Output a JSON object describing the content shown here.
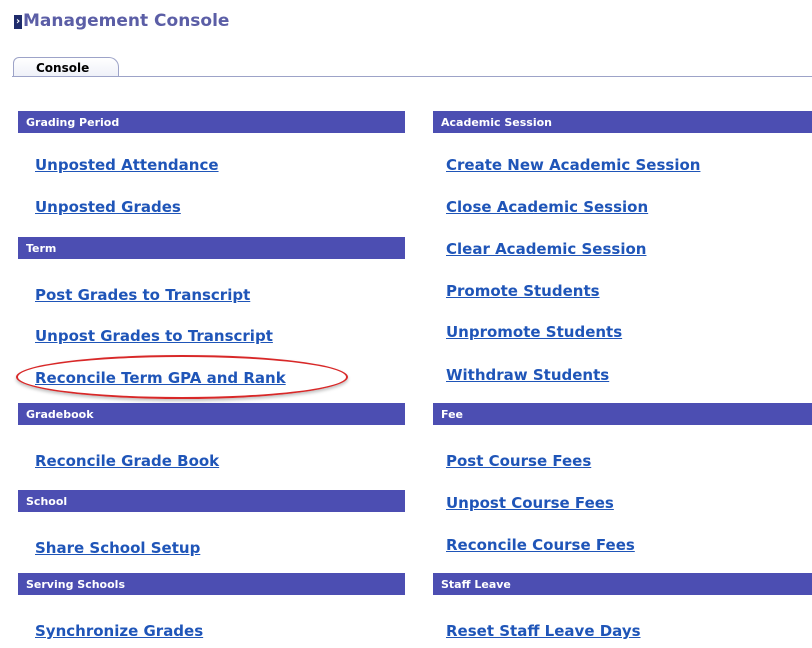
{
  "header": {
    "title": "Management Console",
    "icon": "chevron-right-icon"
  },
  "tabs": [
    {
      "label": "Console"
    }
  ],
  "left": {
    "grading_period": {
      "label": "Grading Period",
      "links": [
        "Unposted Attendance",
        "Unposted Grades"
      ]
    },
    "term": {
      "label": "Term",
      "links": [
        "Post Grades to Transcript",
        "Unpost Grades to Transcript",
        "Reconcile Term GPA and Rank"
      ]
    },
    "gradebook": {
      "label": "Gradebook",
      "links": [
        "Reconcile Grade Book"
      ]
    },
    "school": {
      "label": "School",
      "links": [
        "Share School Setup"
      ]
    },
    "serving_schools": {
      "label": "Serving Schools",
      "links": [
        "Synchronize Grades"
      ]
    }
  },
  "right": {
    "academic_session": {
      "label": "Academic Session",
      "links": [
        "Create New Academic Session",
        "Close Academic Session",
        "Clear Academic Session",
        "Promote Students",
        "Unpromote Students",
        "Withdraw Students"
      ]
    },
    "fee": {
      "label": "Fee",
      "links": [
        "Post Course Fees",
        "Unpost Course Fees",
        "Reconcile Course Fees"
      ]
    },
    "staff_leave": {
      "label": "Staff Leave",
      "links": [
        "Reset Staff Leave Days"
      ]
    }
  },
  "colors": {
    "section_header": "#4c4eb2",
    "link": "#1f55b8",
    "title": "#5b5ea6",
    "highlight": "#d82828"
  }
}
